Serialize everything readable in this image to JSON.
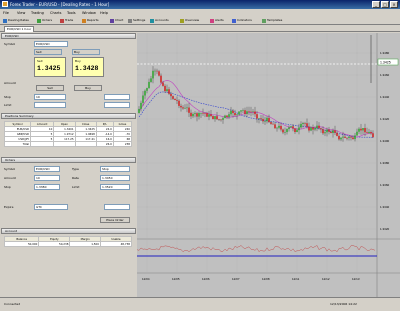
{
  "window": {
    "title": "Forex Trader - EUR/USD - [Dealing Rates - 1 Hour]"
  },
  "menu": [
    "File",
    "View",
    "Trading",
    "Charts",
    "Tools",
    "Window",
    "Help"
  ],
  "toolbar": [
    "Dealing Rates",
    "Orders",
    "Trade",
    "Reports",
    "Chart",
    "Settings",
    "Accounts",
    "Overview",
    "Alerts",
    "Indicators",
    "Templates"
  ],
  "tab": {
    "label": "EUR/USD 1 hour"
  },
  "panel": {
    "header": "EUR/USD",
    "symbol": "EUR/USD",
    "sell_label": "Sell",
    "buy_label": "Buy",
    "sell_price": "1.3425",
    "buy_price": "1.3428",
    "amount_label": "Amount",
    "amount_value": "10",
    "stop_label": "Stop",
    "limit_label": "Limit",
    "buy_button": "Buy",
    "sell_button": "Sell",
    "positions_header": "Positions Summary",
    "positions_cols": [
      "Symbol",
      "Amount",
      "Open",
      "Close",
      "P/L",
      "Gross"
    ],
    "positions_rows": [
      [
        "EUR/USD",
        "10",
        "1.3401",
        "1.3425",
        "24.0",
        "240"
      ],
      [
        "GBP/USD",
        "5",
        "1.9712",
        "1.9698",
        "-14.0",
        "-70"
      ],
      [
        "USD/JPY",
        "5",
        "117.25",
        "117.41",
        "16.0",
        "68"
      ],
      [
        "Total",
        "",
        "",
        "",
        "26.0",
        "238"
      ]
    ],
    "orders_header": "Orders",
    "order_symbol_label": "Symbol",
    "order_symbol": "EUR/USD",
    "order_type_label": "Type",
    "order_type": "Stop",
    "order_amount_label": "Amount",
    "order_amount": "10",
    "order_rate_label": "Rate",
    "order_rate": "1.3450",
    "order_stop_label": "Stop",
    "order_stop": "1.3380",
    "order_limit_label": "Limit",
    "order_limit": "1.3520",
    "order_expire_label": "Expire",
    "order_expire": "GTC",
    "order_btn": "Place Order",
    "account_header": "Account",
    "account_cols": [
      "Balance",
      "Equity",
      "Margin",
      "Usable"
    ],
    "account_row": [
      "50,000",
      "50,238",
      "1,500",
      "48,738"
    ]
  },
  "chart": {
    "price_labels": [
      "1.3480",
      "1.3460",
      "1.3440",
      "1.3420",
      "1.3400",
      "1.3380",
      "1.3360",
      "1.3340",
      "1.3320"
    ],
    "time_labels": [
      "12/04",
      "12/05",
      "12/06",
      "12/07",
      "12/08",
      "12/11",
      "12/12",
      "12/13"
    ],
    "current_price": "1.3425"
  },
  "status": {
    "left": "Connected",
    "right": "12/13/2006 14:22"
  }
}
